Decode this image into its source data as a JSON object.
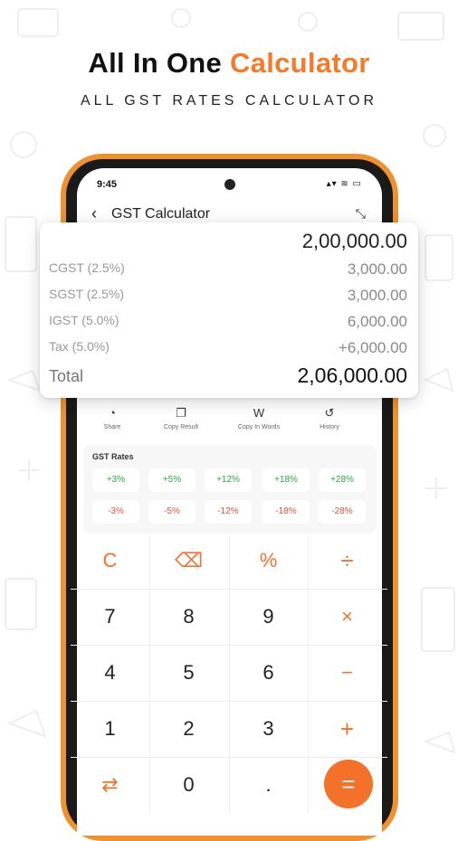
{
  "headline": {
    "prefix": "All In One",
    "accent": "Calculator"
  },
  "subhead": "ALL GST RATES CALCULATOR",
  "status": {
    "time": "9:45",
    "icons": "▴▾ ≋ ▭"
  },
  "appbar": {
    "back_icon": "‹",
    "title": "GST Calculator",
    "collapse_icon": "⤡"
  },
  "result": {
    "main": "2,00,000.00",
    "rows": [
      {
        "label": "CGST (2.5%)",
        "value": "3,000.00"
      },
      {
        "label": "SGST (2.5%)",
        "value": "3,000.00"
      },
      {
        "label": "IGST (5.0%)",
        "value": "6,000.00"
      },
      {
        "label": "Tax (5.0%)",
        "value": "+6,000.00"
      }
    ],
    "total_label": "Total",
    "total_value": "2,06,000.00"
  },
  "actions": [
    {
      "icon": "whatsapp-icon",
      "glyph": "◔",
      "label": "Share"
    },
    {
      "icon": "copy-icon",
      "glyph": "❐",
      "label": "Copy Result"
    },
    {
      "icon": "words-icon",
      "glyph": "W",
      "label": "Copy In Words"
    },
    {
      "icon": "history-icon",
      "glyph": "↺",
      "label": "History"
    }
  ],
  "rates": {
    "title": "GST Rates",
    "plus": [
      "+3%",
      "+5%",
      "+12%",
      "+18%",
      "+28%"
    ],
    "minus": [
      "-3%",
      "-5%",
      "-12%",
      "-18%",
      "-28%"
    ]
  },
  "keypad": {
    "row1": [
      "C",
      "⌫",
      "%",
      "÷"
    ],
    "row2": [
      "7",
      "8",
      "9",
      "×"
    ],
    "row3": [
      "4",
      "5",
      "6",
      "−"
    ],
    "row4": [
      "1",
      "2",
      "3",
      "+"
    ],
    "row5": [
      "⇄",
      "0",
      ".",
      "="
    ]
  },
  "colors": {
    "accent": "#f47b2a",
    "phone_frame": "#f0912d",
    "positive": "#27a744",
    "negative": "#e0503a"
  }
}
